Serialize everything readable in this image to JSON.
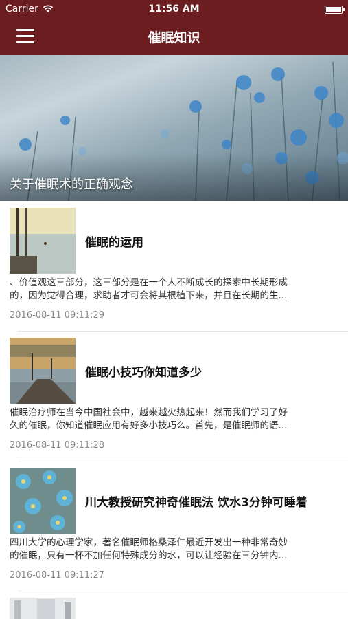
{
  "status": {
    "carrier": "Carrier",
    "time": "11:56 AM"
  },
  "nav": {
    "title": "催眠知识"
  },
  "hero": {
    "caption": "关于催眠术的正确观念"
  },
  "articles": [
    {
      "title": "催眠的运用",
      "summary1": "、价值观这三部分，这三部分是在一个人不断成长的探索中长期形成",
      "summary2": "的，因为觉得合理，求助者才可会将其根植下来，并且在长期的生...",
      "date": "2016-08-11 09:11:29"
    },
    {
      "title": "催眠小技巧你知道多少",
      "summary1": "催眠治疗师在当今中国社会中，越来越火热起来！然而我们学习了好",
      "summary2": "久的催眠，你知道催眠应用有好多小技巧么。首先，是催眠师的语...",
      "date": "2016-08-11 09:11:28"
    },
    {
      "title": "川大教授研究神奇催眠法 饮水3分钟可睡着",
      "summary1": "四川大学的心理学家，著名催眠师格桑泽仁最近开发出一种非常奇妙",
      "summary2": "的催眠，只有一杯不加任何特殊成分的水，可以让经验在三分钟内...",
      "date": "2016-08-11 09:11:27"
    }
  ],
  "colors": {
    "nav_bg": "#6b1d1f"
  }
}
